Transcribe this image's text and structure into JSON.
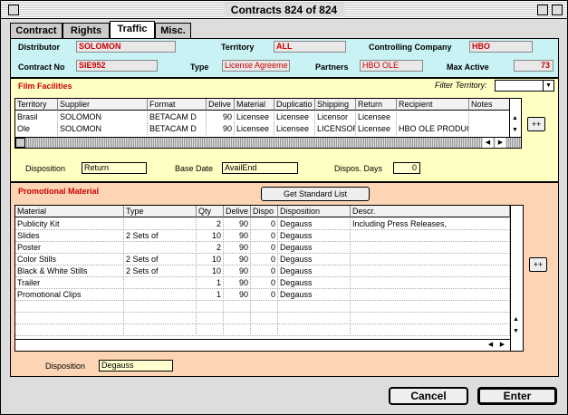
{
  "window": {
    "title": "Contracts 824 of 824"
  },
  "tabs": [
    "Contract",
    "Rights",
    "Traffic",
    "Misc."
  ],
  "header": {
    "distributor_label": "Distributor",
    "distributor": "SOLOMON",
    "territory_label": "Territory",
    "territory": "ALL",
    "controlling_label": "Controlling Company",
    "controlling": "HBO",
    "contract_no_label": "Contract No",
    "contract_no": "SIE952",
    "type_label": "Type",
    "type": "License Agreeme",
    "partners_label": "Partners",
    "partners": "HBO OLE",
    "max_active_label": "Max Active",
    "max_active": "73"
  },
  "film": {
    "title": "Film Facilities",
    "filter_label": "Filter Territory:",
    "columns": [
      "Territory",
      "Supplier",
      "Format",
      "Delive",
      "Material",
      "Duplicatio",
      "Shipping",
      "Return",
      "Recipient",
      "Notes"
    ],
    "rows": [
      [
        "Brasil",
        "SOLOMON",
        "BETACAM D",
        "90",
        "Licensee",
        "Licensee",
        "Licensor",
        "Licensee",
        "",
        ""
      ],
      [
        "Ole",
        "SOLOMON",
        "BETACAM D",
        "90",
        "Licensee",
        "Licensee",
        "LICENSOR",
        "Licensee",
        "HBO OLE PRODUC",
        ""
      ]
    ],
    "disposition_label": "Disposition",
    "disposition": "Return",
    "base_date_label": "Base Date",
    "base_date": "AvailEnd",
    "dispos_days_label": "Dispos. Days",
    "dispos_days": "0"
  },
  "promo": {
    "title": "Promotional Material",
    "get_list_button": "Get Standard List",
    "columns": [
      "Material",
      "Type",
      "Qty",
      "Delive",
      "Dispo",
      "Disposition",
      "Descr."
    ],
    "rows": [
      [
        "Publicity Kit",
        "",
        "2",
        "90",
        "0",
        "Degauss",
        "Including Press Releases,"
      ],
      [
        "Slides",
        "2 Sets of",
        "10",
        "90",
        "0",
        "Degauss",
        ""
      ],
      [
        "Poster",
        "",
        "2",
        "90",
        "0",
        "Degauss",
        ""
      ],
      [
        "Color Stills",
        "2 Sets of",
        "10",
        "90",
        "0",
        "Degauss",
        ""
      ],
      [
        "Black & White Stills",
        "2 Sets of",
        "10",
        "90",
        "0",
        "Degauss",
        ""
      ],
      [
        "Trailer",
        "",
        "1",
        "90",
        "0",
        "Degauss",
        ""
      ],
      [
        "Promotional Clips",
        "",
        "1",
        "90",
        "0",
        "Degauss",
        ""
      ]
    ],
    "disposition_label": "Disposition",
    "disposition": "Degauss"
  },
  "plus_label": "++",
  "buttons": {
    "cancel": "Cancel",
    "enter": "Enter"
  }
}
